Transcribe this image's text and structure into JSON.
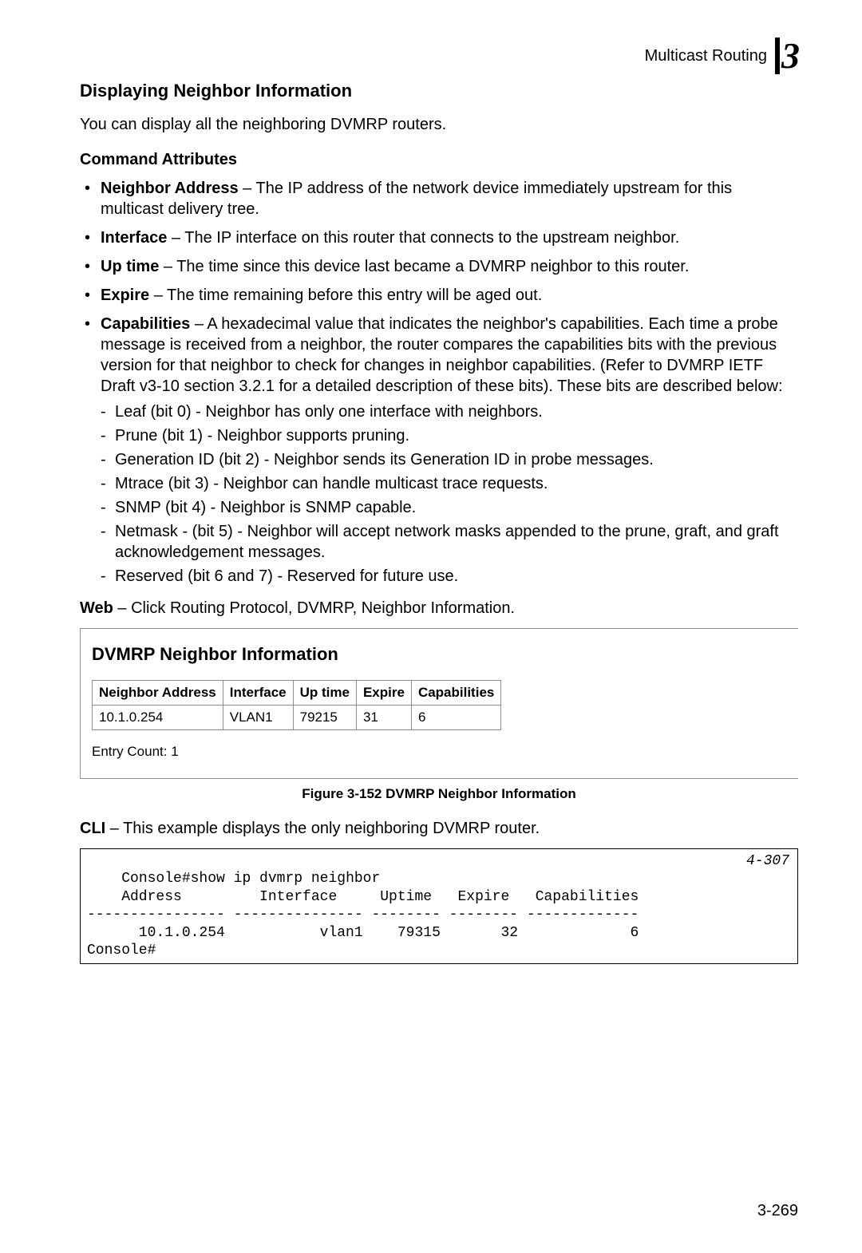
{
  "header": {
    "section": "Multicast Routing",
    "chapter": "3"
  },
  "heading1": "Displaying Neighbor Information",
  "intro": "You can display all the neighboring DVMRP routers.",
  "heading2": "Command Attributes",
  "attrs": [
    {
      "term": "Neighbor Address",
      "desc": " – The IP address of the network device immediately upstream for this multicast delivery tree."
    },
    {
      "term": "Interface",
      "desc": " – The IP interface on this router that connects to the upstream neighbor."
    },
    {
      "term": "Up time",
      "desc": " – The time since this device last became a DVMRP neighbor to this router."
    },
    {
      "term": "Expire",
      "desc": " – The time remaining before this entry will be aged out."
    },
    {
      "term": "Capabilities",
      "desc": " – A hexadecimal value that indicates the neighbor's capabilities. Each time a probe message is received from a neighbor, the router compares the capabilities bits with the previous version for that neighbor to check for changes in neighbor capabilities. (Refer to DVMRP IETF Draft v3-10 section 3.2.1 for a detailed description of these bits). These bits are described below:"
    }
  ],
  "bits": [
    "Leaf (bit 0) - Neighbor has only one interface with neighbors.",
    "Prune (bit 1) - Neighbor supports pruning.",
    "Generation ID (bit 2) - Neighbor sends its Generation ID in probe messages.",
    "Mtrace (bit 3) - Neighbor can handle multicast trace requests.",
    "SNMP (bit 4) - Neighbor is SNMP capable.",
    "Netmask - (bit 5) - Neighbor will accept network masks appended to the prune, graft, and graft acknowledgement messages.",
    "Reserved (bit 6 and 7) - Reserved for future use."
  ],
  "web": {
    "lead": "Web",
    "text": " – Click Routing Protocol, DVMRP, Neighbor Information."
  },
  "panel": {
    "title": "DVMRP Neighbor Information",
    "cols": [
      "Neighbor Address",
      "Interface",
      "Up time",
      "Expire",
      "Capabilities"
    ],
    "row": [
      "10.1.0.254",
      "VLAN1",
      "79215",
      "31",
      "6"
    ],
    "entry": "Entry Count: 1"
  },
  "figcap": "Figure 3-152   DVMRP Neighbor Information",
  "cli": {
    "lead": "CLI",
    "text": " – This example displays the only neighboring DVMRP router."
  },
  "clibox": {
    "ref": "4-307",
    "lines": [
      "Console#show ip dvmrp neighbor",
      "    Address         Interface     Uptime   Expire   Capabilities",
      "---------------- --------------- -------- -------- -------------",
      "      10.1.0.254           vlan1    79315       32             6",
      "Console#"
    ]
  },
  "pagefoot": "3-269"
}
